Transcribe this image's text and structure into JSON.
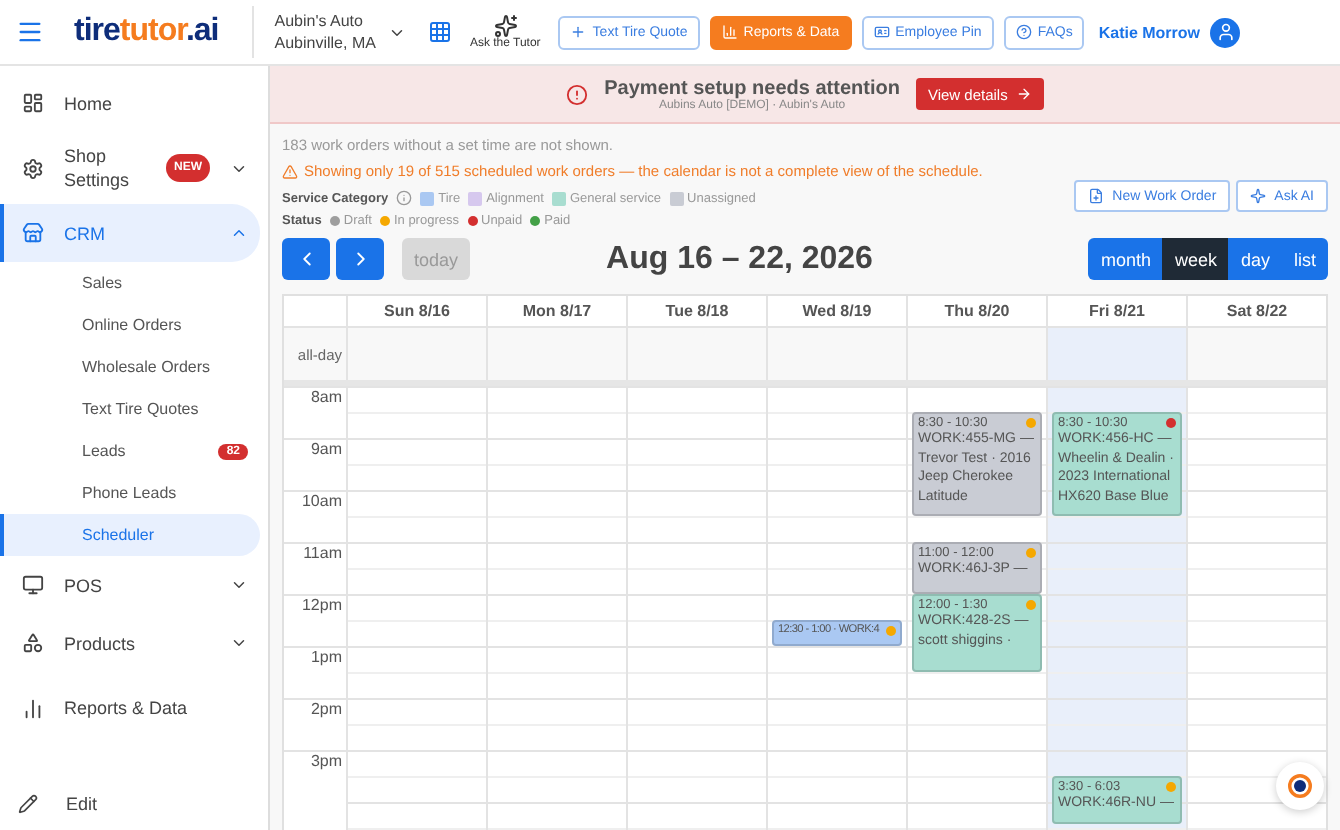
{
  "header": {
    "logo": [
      "tire",
      "tutor",
      ".ai"
    ],
    "shop": {
      "name": "Aubin's Auto",
      "location": "Aubinville, MA"
    },
    "ask_tutor": "Ask the Tutor",
    "buttons": [
      {
        "kind": "plus",
        "label": "Text Tire Quote",
        "primary": false
      },
      {
        "kind": "chart",
        "label": "Reports & Data",
        "primary": true
      },
      {
        "kind": "pin",
        "label": "Employee Pin",
        "primary": false
      },
      {
        "kind": "help",
        "label": "FAQs",
        "primary": false
      }
    ],
    "user": "Katie Morrow"
  },
  "sidebar": {
    "items": [
      {
        "kind": "home",
        "label": "Home",
        "selected": false
      },
      {
        "kind": "gear",
        "label": "Shop Settings",
        "selected": false,
        "badge": "NEW",
        "expanded": false
      },
      {
        "kind": "store",
        "label": "CRM",
        "selected": true,
        "expanded": true,
        "children": [
          {
            "label": "Sales",
            "selected": false
          },
          {
            "label": "Online Orders",
            "selected": false
          },
          {
            "label": "Wholesale Orders",
            "selected": false
          },
          {
            "label": "Text Tire Quotes",
            "selected": false
          },
          {
            "label": "Leads",
            "selected": false,
            "badge": "82"
          },
          {
            "label": "Phone Leads",
            "selected": false
          },
          {
            "label": "Scheduler",
            "selected": true
          }
        ]
      },
      {
        "kind": "monitor",
        "label": "POS",
        "selected": false,
        "expanded": false
      },
      {
        "kind": "shapes",
        "label": "Products",
        "selected": false,
        "expanded": false
      },
      {
        "kind": "bars",
        "label": "Reports & Data",
        "selected": false
      }
    ],
    "edit": "Edit"
  },
  "banner": {
    "title": "Payment setup needs attention",
    "subtitle": "Aubins Auto [DEMO] · Aubin's Auto",
    "button": "View details"
  },
  "notice": "183 work orders without a set time are not shown.",
  "warning": "Showing only 19 of 515 scheduled work orders — the calendar is not a complete view of the schedule.",
  "legend": {
    "category_label": "Service Category",
    "categories": [
      {
        "label": "Tire",
        "color": "#aac8f2"
      },
      {
        "label": "Alignment",
        "color": "#d6c8ee"
      },
      {
        "label": "General service",
        "color": "#a8ddd0"
      },
      {
        "label": "Unassigned",
        "color": "#c9ccd4"
      }
    ],
    "status_label": "Status",
    "statuses": [
      {
        "label": "Draft",
        "color": "#9e9e9e"
      },
      {
        "label": "In progress",
        "color": "#f5a800"
      },
      {
        "label": "Unpaid",
        "color": "#d32f2f"
      },
      {
        "label": "Paid",
        "color": "#43a047"
      }
    ]
  },
  "actions": [
    "New Work Order",
    "Ask AI"
  ],
  "nav": {
    "today": "today",
    "today_disabled": true,
    "title": "Aug 16 – 22, 2026"
  },
  "views": [
    {
      "label": "month",
      "selected": false
    },
    {
      "label": "week",
      "selected": true
    },
    {
      "label": "day",
      "selected": false
    },
    {
      "label": "list",
      "selected": false
    }
  ],
  "calendar": {
    "all_day": "all-day",
    "hours": [
      "8am",
      "9am",
      "10am",
      "11am",
      "12pm",
      "1pm",
      "2pm",
      "3pm"
    ],
    "days": [
      {
        "label": "Sun 8/16",
        "today": false
      },
      {
        "label": "Mon 8/17",
        "today": false
      },
      {
        "label": "Tue 8/18",
        "today": false
      },
      {
        "label": "Wed 8/19",
        "today": false,
        "events": [
          {
            "time": "12:30 - 1:00 · WORK:4",
            "color": "#aac8f2",
            "status": {
              "color": "#f5a800"
            }
          }
        ]
      },
      {
        "label": "Thu 8/20",
        "today": false,
        "events": [
          {
            "time": "8:30 - 10:30",
            "text": "WORK:455-MG — Trevor Test · 2016 Jeep Cherokee Latitude",
            "color": "#c9ccd4",
            "status": {
              "color": "#f5a800"
            }
          },
          {
            "time": "11:00 - 12:00",
            "text": "WORK:46J-3P —",
            "color": "#c9ccd4",
            "status": {
              "color": "#f5a800"
            }
          },
          {
            "time": "12:00 - 1:30",
            "text": "WORK:428-2S — scott shiggins ·",
            "color": "#a8ddd0",
            "status": {
              "color": "#f5a800"
            }
          }
        ]
      },
      {
        "label": "Fri 8/21",
        "today": true,
        "events": [
          {
            "time": "8:30 - 10:30",
            "text": "WORK:456-HC — Wheelin & Dealin · 2023 International HX620 Base Blue",
            "color": "#a8ddd0",
            "status": {
              "color": "#d32f2f"
            }
          },
          {
            "time": "3:30 - 6:03",
            "text": "WORK:46R-NU —",
            "color": "#a8ddd0",
            "status": {
              "color": "#f5a800"
            }
          }
        ]
      },
      {
        "label": "Sat 8/22",
        "today": false
      }
    ]
  }
}
